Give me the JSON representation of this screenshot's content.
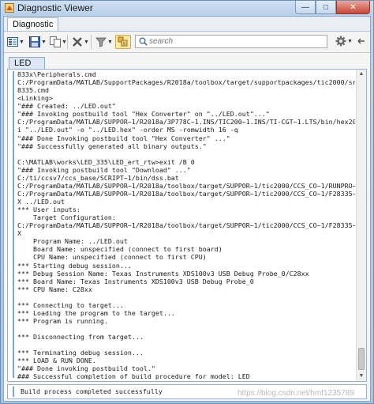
{
  "window": {
    "title": "Diagnostic Viewer",
    "controls": {
      "minimize": "—",
      "maximize": "□",
      "close": "✕"
    }
  },
  "tabs": {
    "active": "Diagnostic"
  },
  "toolbar": {
    "icons": [
      "view-menu-icon",
      "save-icon",
      "copy-icon",
      "delete-icon",
      "filter-icon",
      "group-icon",
      "gear-icon",
      "pin-icon"
    ],
    "search_placeholder": "search"
  },
  "model_tab": {
    "label": "LED"
  },
  "log": {
    "lines": [
      "833x\\Peripherals.cmd",
      "C:/ProgramData/MATLAB/SupportPackages/R2018a/toolbox/target/supportpackages/tic2000/src/c2",
      "8335.cmd",
      "<Linking>",
      "\"### Created: ../LED.out\"",
      "\"### Invoking postbuild tool \"Hex Converter\" on \"../LED.out\"...\"",
      "C:/ProgramData/MATLAB/SUPPOR~1/R2018a/3P778C~1.INS/TIC200~1.INS/TI-CGT~1.LTS/bin/hex2000 -",
      "i \"../LED.out\" -o \"../LED.hex\" -order MS -romwidth 16 -q",
      "\"### Done Invoking postbuild tool \"Hex Converter\" ...\"",
      "\"### Successfully generated all binary outputs.\"",
      "",
      "C:\\MATLAB\\works\\LED_335\\LED_ert_rtw>exit /B 0",
      "\"### Invoking postbuild tool \"Download\" ...\"",
      "C:/ti/ccsv7/ccs_base/SCRIPT~1/bin/dss.bat",
      "C:/ProgramData/MATLAB/SUPPOR~1/R2018a/toolbox/target/SUPPOR~1/tic2000/CCS_CO~1/RUNPRO~2.JS",
      "C:/ProgramData/MATLAB/SUPPOR~1/R2018a/toolbox/target/SUPPOR~1/tic2000/CCS_CO~1/F28335~2.CC",
      "X ../LED.out",
      "*** User inputs:",
      "    Target Configuration:",
      "C:/ProgramData/MATLAB/SUPPOR~1/R2018a/toolbox/target/SUPPOR~1/tic2000/CCS_CO~1/F28335~2.CC",
      "X",
      "    Program Name: ../LED.out",
      "    Board Name: unspecified (connect to first board)",
      "    CPU Name: unspecified (connect to first CPU)",
      "*** Starting debug session...",
      "*** Debug Session Name: Texas Instruments XDS100v3 USB Debug Probe_0/C28xx",
      "*** Board Name: Texas Instruments XDS100v3 USB Debug Probe_0",
      "*** CPU Name: C28xx",
      "",
      "*** Connecting to target...",
      "*** Loading the program to the target...",
      "*** Program is running.",
      "",
      "*** Disconnecting from target...",
      "",
      "*** Terminating debug session...",
      "*** LOAD & RUN DONE.",
      "\"### Done invoking postbuild tool.\"",
      "### Successful completion of build procedure for model: LED"
    ]
  },
  "status": {
    "message": "Build process completed successfully"
  },
  "watermark": "https://blog.csdn.net/hmf1235789"
}
